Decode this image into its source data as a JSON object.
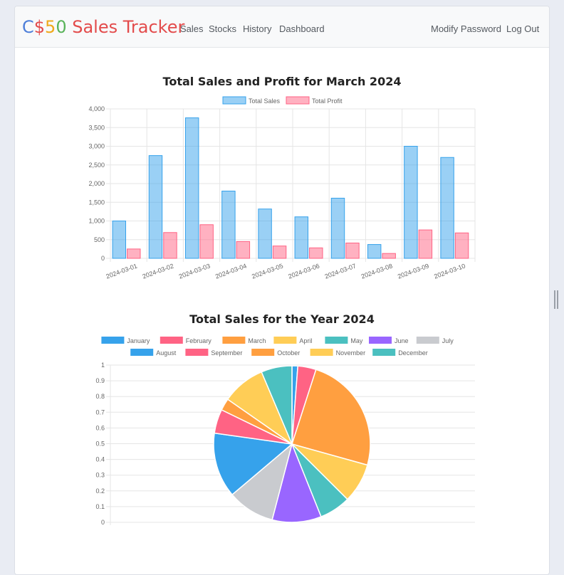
{
  "brand": {
    "letters": [
      {
        "text": "C",
        "color": "#4e7fd9"
      },
      {
        "text": "$",
        "color": "#e34b4b"
      },
      {
        "text": "5",
        "color": "#f0a91b"
      },
      {
        "text": "0",
        "color": "#59b359"
      },
      {
        "text": " Sales Tracker",
        "color": "#e34b4b"
      }
    ]
  },
  "nav": {
    "left": [
      "Sales",
      "Stocks",
      "History",
      "Dashboard"
    ],
    "right": [
      "Modify Password",
      "Log Out"
    ]
  },
  "colors": {
    "sales_fill": "rgba(54,162,235,0.5)",
    "sales_stroke": "#36a2eb",
    "profit_fill": "rgba(255,99,132,0.5)",
    "profit_stroke": "#ff6384",
    "grid": "#e5e5e5",
    "tick_text": "#666666"
  },
  "chart_data": [
    {
      "type": "bar",
      "title": "Total Sales and Profit for March 2024",
      "categories": [
        "2024-03-01",
        "2024-03-02",
        "2024-03-03",
        "2024-03-04",
        "2024-03-05",
        "2024-03-06",
        "2024-03-07",
        "2024-03-08",
        "2024-03-09",
        "2024-03-10"
      ],
      "series": [
        {
          "name": "Total Sales",
          "values": [
            1000,
            2750,
            3760,
            1800,
            1320,
            1110,
            1610,
            370,
            3000,
            2700
          ]
        },
        {
          "name": "Total Profit",
          "values": [
            250,
            690,
            900,
            450,
            330,
            280,
            410,
            130,
            760,
            680
          ]
        }
      ],
      "ylim": [
        0,
        4000
      ],
      "yticks": [
        "4,000",
        "3,500",
        "3,000",
        "2,500",
        "2,000",
        "1,500",
        "1,000",
        "500",
        "0"
      ],
      "legend": "top",
      "grid": true
    },
    {
      "type": "pie",
      "title": "Total Sales for the Year 2024",
      "labels": [
        "January",
        "February",
        "March",
        "April",
        "May",
        "June",
        "July",
        "August",
        "September",
        "October",
        "November",
        "December"
      ],
      "colors": [
        "#36a2eb",
        "#ff6384",
        "#ff9f40",
        "#ffcd56",
        "#4bc0c0",
        "#9966ff",
        "#c9cbcf",
        "#36a2eb",
        "#ff6384",
        "#ff9f40",
        "#ffcd56",
        "#4bc0c0"
      ],
      "values": [
        1.2,
        3.8,
        24.5,
        8.2,
        6.5,
        10.2,
        9.8,
        13.5,
        5.0,
        2.5,
        9.0,
        6.4
      ],
      "yticks": [
        "1",
        "0.9",
        "0.8",
        "0.7",
        "0.6",
        "0.5",
        "0.4",
        "0.3",
        "0.2",
        "0.1",
        "0"
      ],
      "legend": "top",
      "grid": true
    }
  ]
}
